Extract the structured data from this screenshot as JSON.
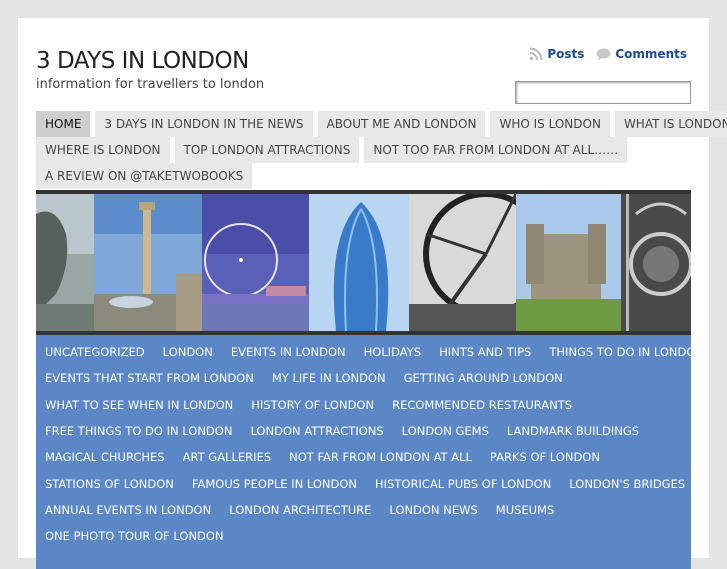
{
  "site": {
    "title": "3 DAYS IN LONDON",
    "description": "information for travellers to london"
  },
  "feeds": {
    "posts_label": "Posts",
    "comments_label": "Comments",
    "posts_icon": "rss-icon",
    "comments_icon": "comment-bubble-icon"
  },
  "search": {
    "value": "",
    "placeholder": ""
  },
  "nav": {
    "rows": [
      [
        "HOME",
        "3 DAYS IN LONDON IN THE NEWS",
        "ABOUT ME AND LONDON",
        "WHO IS LONDON",
        "WHAT IS LONDON"
      ],
      [
        "WHERE IS LONDON",
        "TOP LONDON ATTRACTIONS",
        "NOT TOO FAR FROM LONDON AT ALL……"
      ],
      [
        "A REVIEW ON @TAKETWOBOOKS"
      ]
    ],
    "active": "HOME"
  },
  "banner": {
    "panels": [
      "lion-statue",
      "nelsons-column",
      "london-eye",
      "gherkin",
      "ferris-wheel-bw",
      "tower-of-london",
      "ornate-gate"
    ]
  },
  "categories": {
    "rows": [
      [
        "UNCATEGORIZED",
        "LONDON",
        "EVENTS IN LONDON",
        "HOLIDAYS",
        "HINTS AND TIPS",
        "THINGS TO DO IN LONDON"
      ],
      [
        "EVENTS THAT START FROM LONDON",
        "MY LIFE IN LONDON",
        "GETTING AROUND LONDON"
      ],
      [
        "WHAT TO SEE WHEN IN LONDON",
        "HISTORY OF LONDON",
        "RECOMMENDED RESTAURANTS"
      ],
      [
        "FREE THINGS TO DO IN LONDON",
        "LONDON ATTRACTIONS",
        "LONDON GEMS",
        "LANDMARK BUILDINGS"
      ],
      [
        "MAGICAL CHURCHES",
        "ART GALLERIES",
        "NOT FAR FROM LONDON AT ALL",
        "PARKS OF LONDON"
      ],
      [
        "STATIONS OF LONDON",
        "FAMOUS PEOPLE IN LONDON",
        "HISTORICAL PUBS OF LONDON",
        "LONDON'S BRIDGES"
      ],
      [
        "ANNUAL EVENTS IN LONDON",
        "LONDON ARCHITECTURE",
        "LONDON NEWS",
        "MUSEUMS"
      ],
      [
        "ONE PHOTO TOUR OF LONDON"
      ]
    ]
  },
  "colors": {
    "category_bar": "#5b87c6",
    "link": "#1f4a8f",
    "nav_bg": "#e8e8e8",
    "nav_active_bg": "#cfcfcf"
  }
}
